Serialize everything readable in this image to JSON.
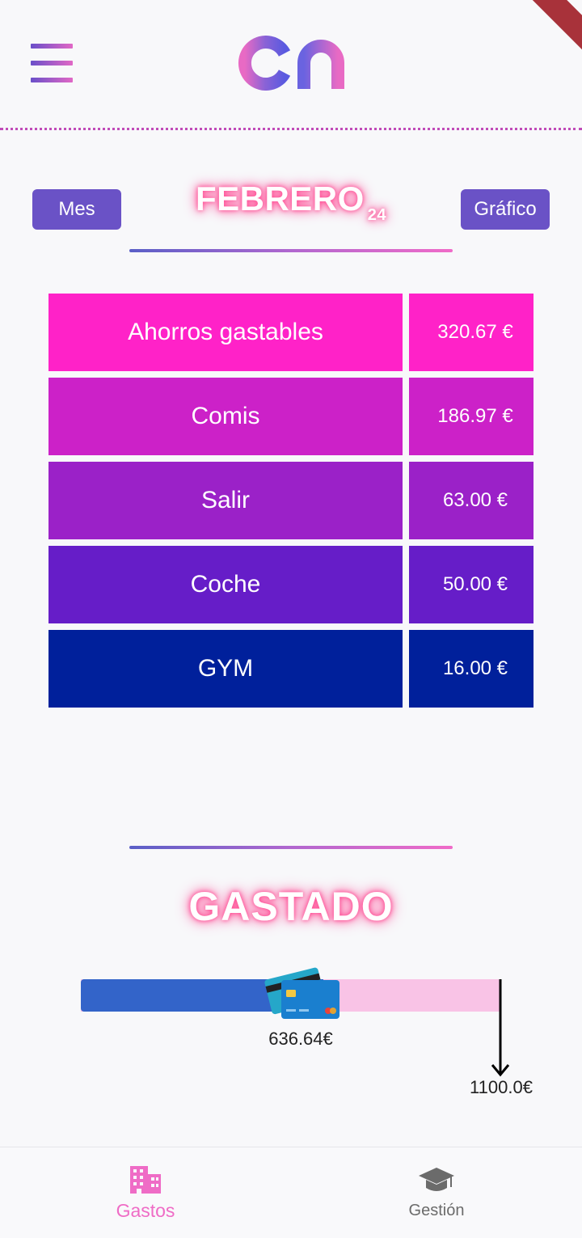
{
  "header": {
    "menu_icon": "hamburger-menu-icon",
    "logo_icon": "co-logo-icon"
  },
  "month": {
    "left_button": "Mes",
    "title": "FEBRERO",
    "year": "24",
    "right_button": "Gráfico"
  },
  "categories": [
    {
      "name": "Ahorros gastables",
      "value": "320.67 €",
      "color": "#ff22c8"
    },
    {
      "name": "Comis",
      "value": "186.97 €",
      "color": "#cc21c8"
    },
    {
      "name": "Salir",
      "value": "63.00 €",
      "color": "#9b21c8"
    },
    {
      "name": "Coche",
      "value": "50.00 €",
      "color": "#661dc8"
    },
    {
      "name": "GYM",
      "value": "16.00 €",
      "color": "#00209b"
    }
  ],
  "gastado": {
    "title": "GASTADO",
    "spent_label": "636.64€",
    "limit_label": "1100.0€",
    "spent_fraction": 0.5787,
    "fill_color": "#3364c9",
    "track_color": "#f9c3e6",
    "icon": "credit-cards-icon"
  },
  "bottom_nav": {
    "items": [
      {
        "label": "Gastos",
        "icon": "building-icon",
        "active": true
      },
      {
        "label": "Gestión",
        "icon": "graduation-cap-icon",
        "active": false
      }
    ]
  }
}
